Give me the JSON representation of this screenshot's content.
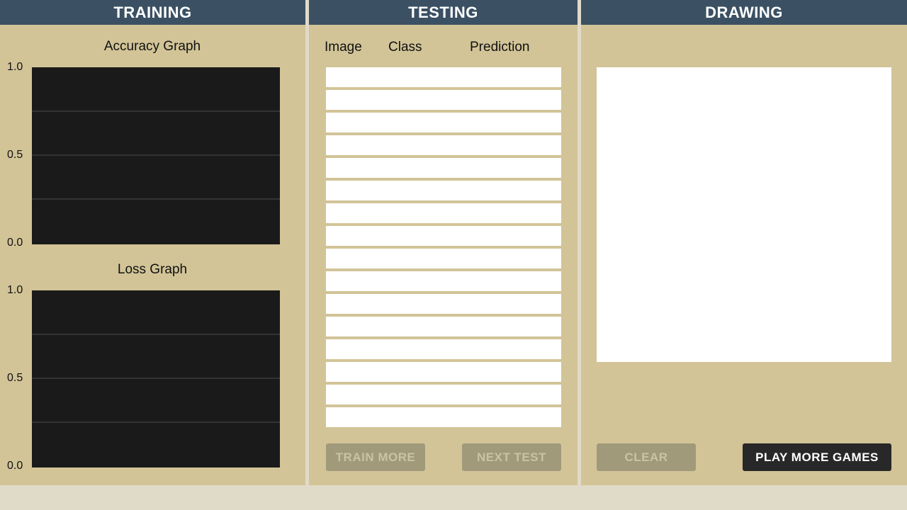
{
  "training": {
    "header": "TRAINING",
    "accuracy_graph": {
      "title": "Accuracy Graph",
      "ticks": [
        "1.0",
        "0.5",
        "0.0"
      ]
    },
    "loss_graph": {
      "title": "Loss Graph",
      "ticks": [
        "1.0",
        "0.5",
        "0.0"
      ]
    }
  },
  "testing": {
    "header": "TESTING",
    "columns": {
      "image": "Image",
      "class": "Class",
      "prediction": "Prediction"
    },
    "row_count": 16,
    "train_more_label": "TRAIN MORE",
    "next_test_label": "NEXT TEST"
  },
  "drawing": {
    "header": "DRAWING",
    "clear_label": "CLEAR",
    "play_more_label": "PLAY MORE GAMES"
  },
  "colors": {
    "header_bg": "#3b5063",
    "panel_bg": "#d2c497",
    "graph_bg": "#1a1a1a",
    "disabled_button": "#a09a7b",
    "primary_button": "#282828"
  }
}
